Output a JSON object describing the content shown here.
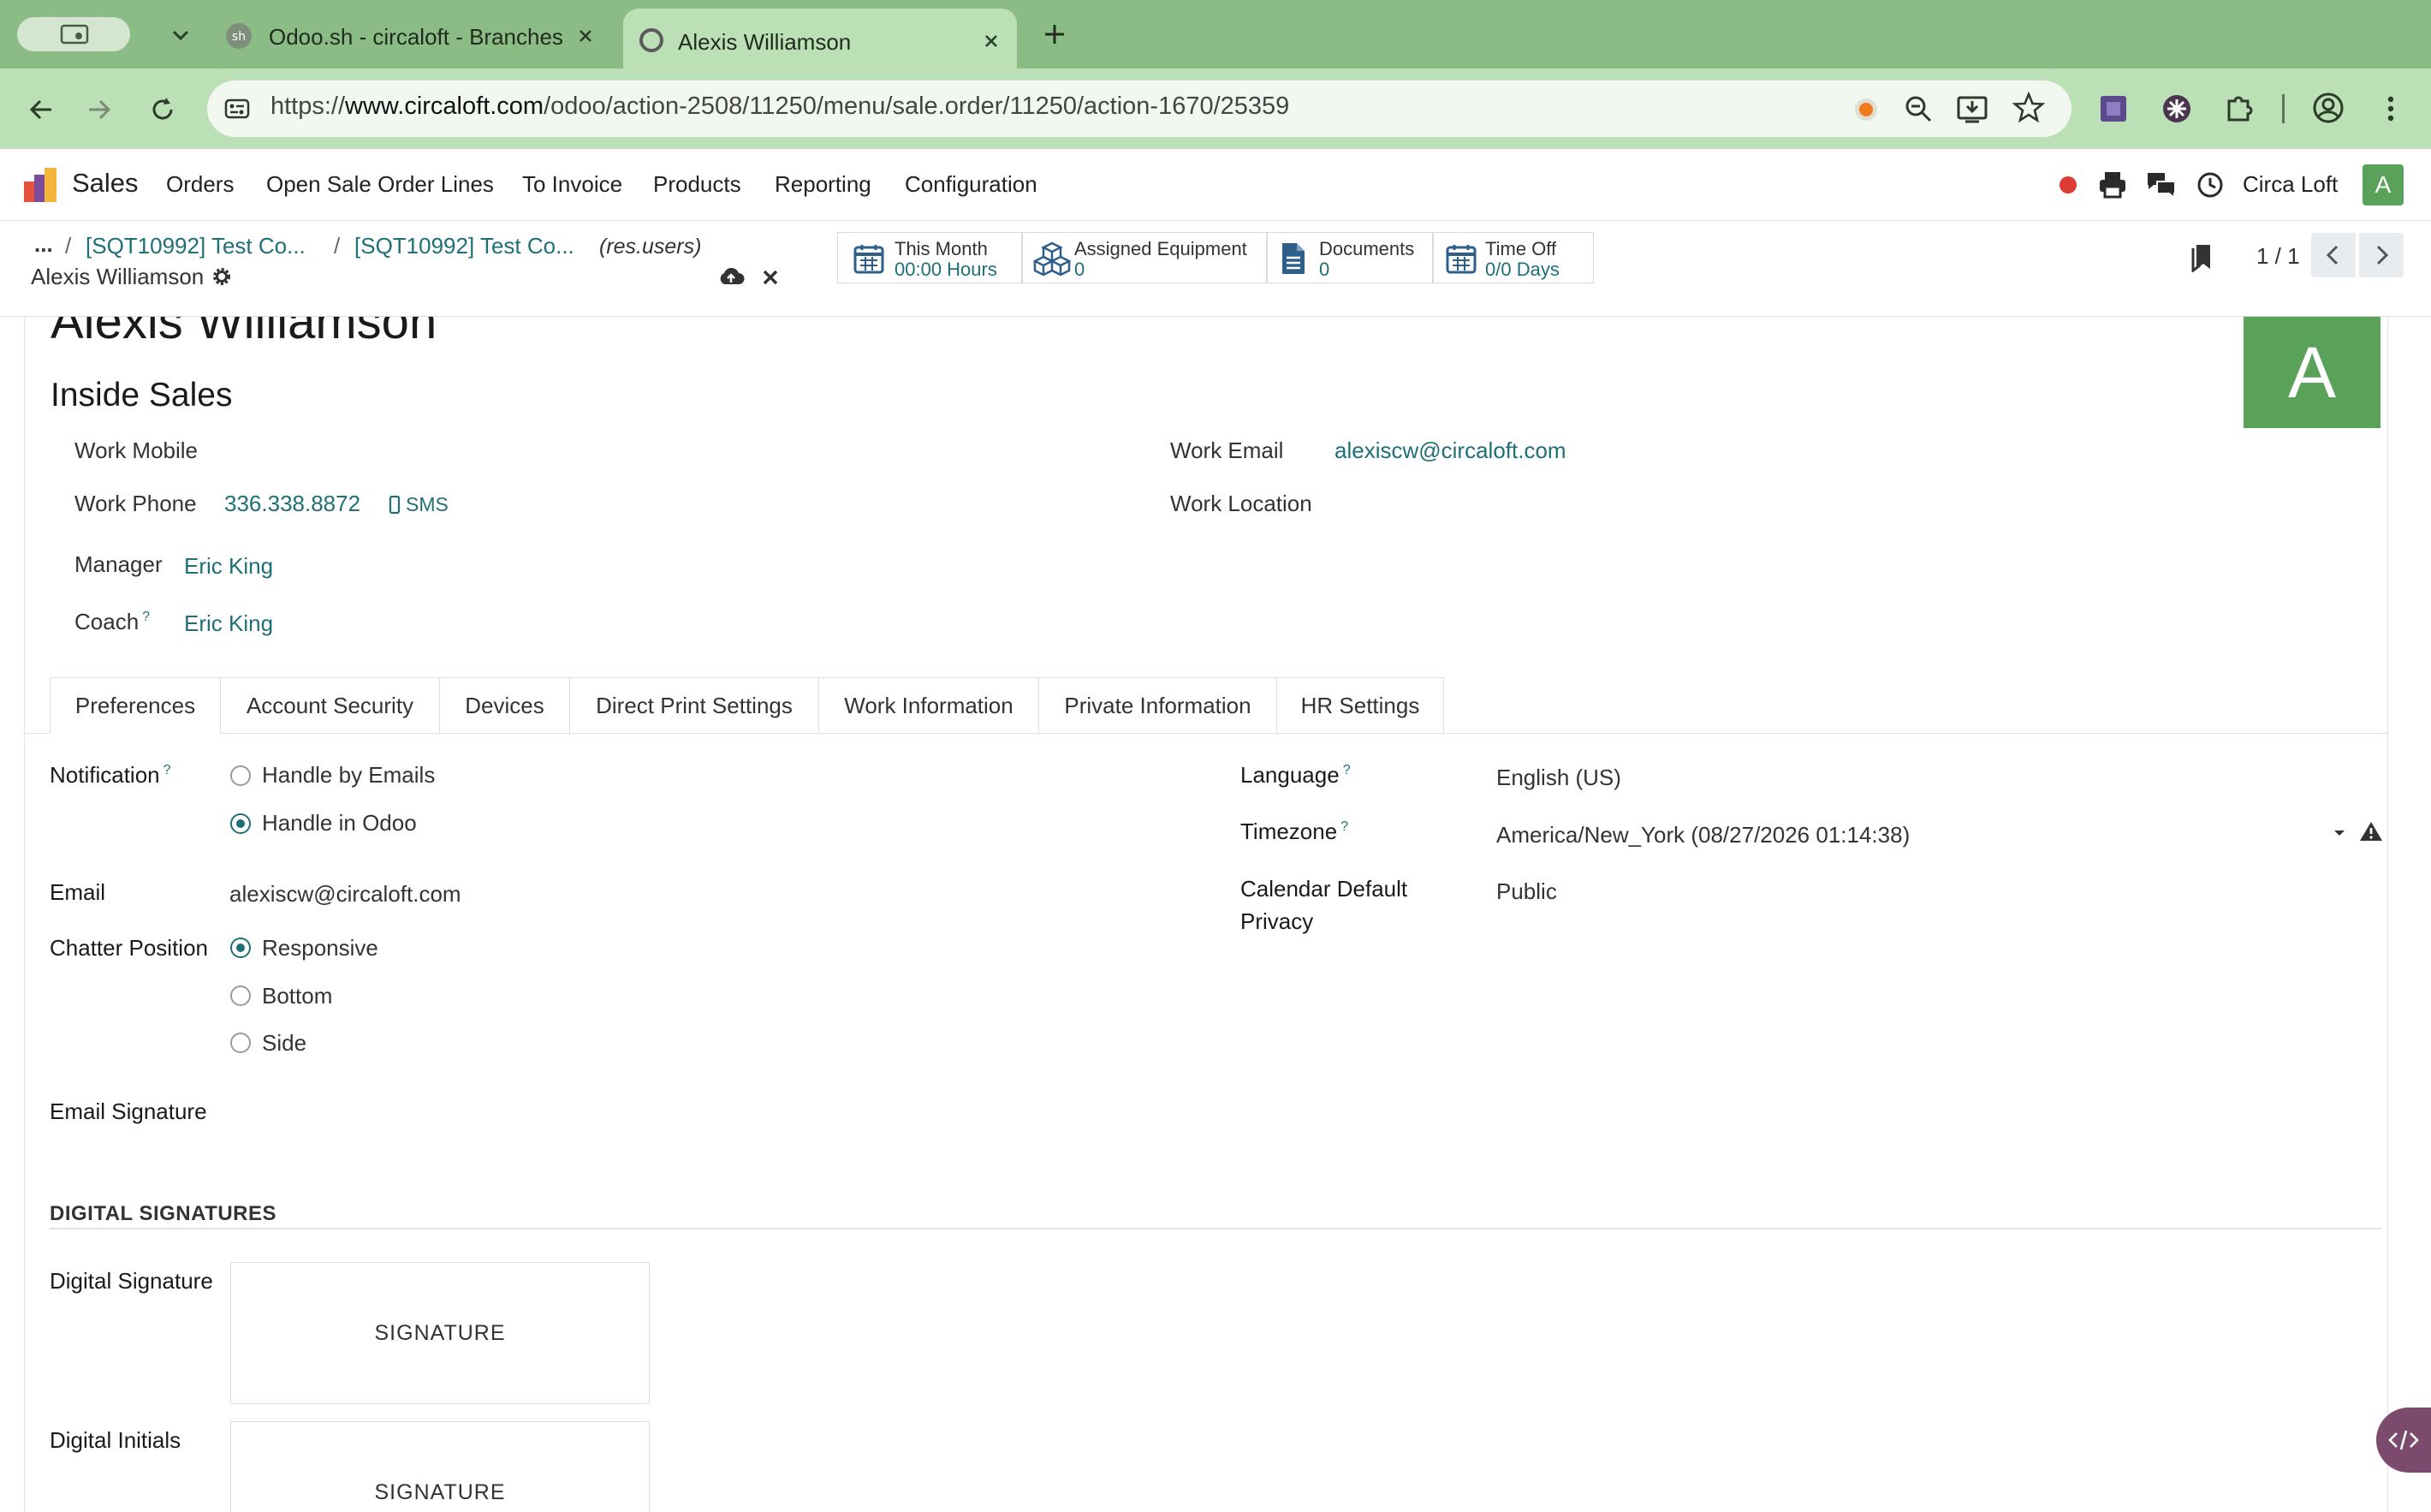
{
  "browser": {
    "tabs": [
      {
        "title": "Odoo.sh - circaloft - Branches",
        "favicon": "odoo-sh-icon"
      },
      {
        "title": "Alexis Williamson",
        "favicon": "page-icon"
      }
    ],
    "url_prefix": "https://",
    "url_host": "www.circaloft.com",
    "url_path": "/odoo/action-2508/11250/menu/sale.order/11250/action-1670/25359"
  },
  "navbar": {
    "app_name": "Sales",
    "menu": [
      "Orders",
      "Open Sale Order Lines",
      "To Invoice",
      "Products",
      "Reporting",
      "Configuration"
    ],
    "company": "Circa Loft",
    "avatar_letter": "A",
    "avatar_color": "#5aa25a"
  },
  "control_panel": {
    "breadcrumb_more": "...",
    "breadcrumb": [
      "[SQT10992] Test Co...",
      "[SQT10992] Test Co..."
    ],
    "model_hint": "(res.users)",
    "record_name": "Alexis Williamson",
    "stats": [
      {
        "label": "This Month",
        "value": "00:00 Hours",
        "icon": "calendar-icon"
      },
      {
        "label": "Assigned Equipment",
        "value": "0",
        "icon": "cubes-icon"
      },
      {
        "label": "Documents",
        "value": "0",
        "icon": "document-icon"
      },
      {
        "label": "Time Off",
        "value": "0/0 Days",
        "icon": "calendar-icon"
      }
    ],
    "pager": "1 / 1"
  },
  "employee": {
    "name": "Alexis Williamson",
    "job_title": "Inside Sales",
    "avatar_letter": "A",
    "work_mobile_label": "Work Mobile",
    "work_phone_label": "Work Phone",
    "work_phone": "336.338.8872",
    "sms_label": "SMS",
    "manager_label": "Manager",
    "manager": "Eric King",
    "coach_label": "Coach",
    "coach": "Eric King",
    "work_email_label": "Work Email",
    "work_email": "alexiscw@circaloft.com",
    "work_location_label": "Work Location"
  },
  "form_tabs": [
    "Preferences",
    "Account Security",
    "Devices",
    "Direct Print Settings",
    "Work Information",
    "Private Information",
    "HR Settings"
  ],
  "preferences": {
    "notification_label": "Notification",
    "notification_options": [
      "Handle by Emails",
      "Handle in Odoo"
    ],
    "notification_selected": "Handle in Odoo",
    "email_label": "Email",
    "email": "alexiscw@circaloft.com",
    "chatter_label": "Chatter Position",
    "chatter_options": [
      "Responsive",
      "Bottom",
      "Side"
    ],
    "chatter_selected": "Responsive",
    "email_signature_label": "Email Signature",
    "language_label": "Language",
    "language": "English (US)",
    "timezone_label": "Timezone",
    "timezone": "America/New_York (08/27/2026 01:14:38)",
    "calendar_privacy_label_1": "Calendar Default",
    "calendar_privacy_label_2": "Privacy",
    "calendar_privacy": "Public",
    "digital_signatures_title": "DIGITAL SIGNATURES",
    "digital_signature_label": "Digital Signature",
    "digital_initials_label": "Digital Initials",
    "signature_placeholder": "SIGNATURE"
  }
}
